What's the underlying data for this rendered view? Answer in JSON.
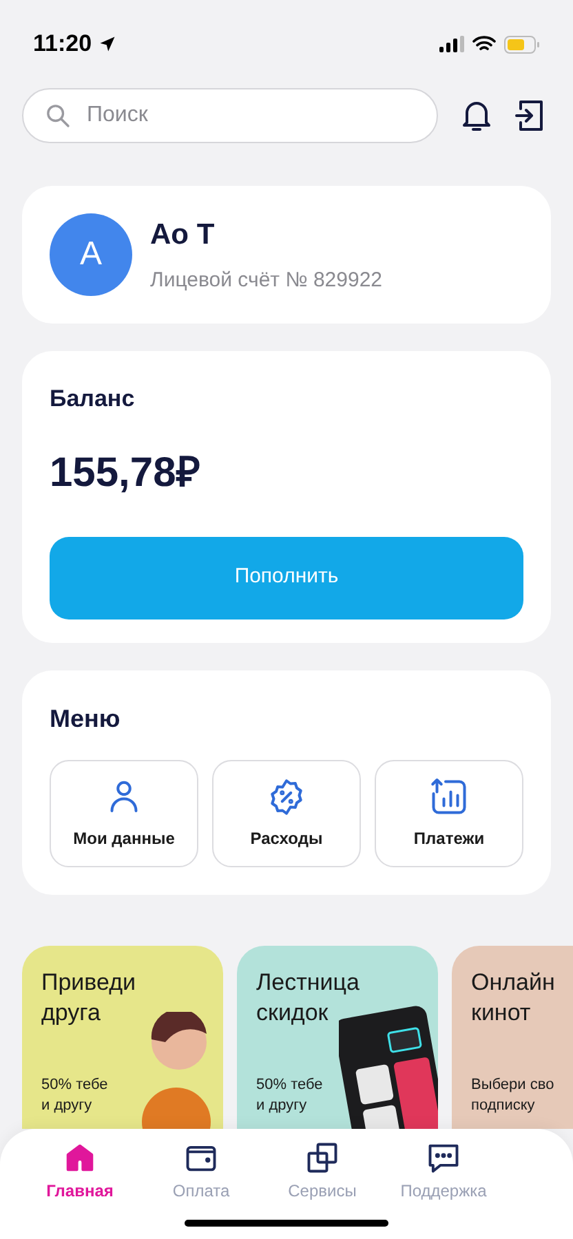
{
  "status_bar": {
    "time": "11:20"
  },
  "search": {
    "placeholder": "Поиск"
  },
  "profile": {
    "initial": "A",
    "name": "Ao T",
    "account": "Лицевой счёт № 829922"
  },
  "balance": {
    "title": "Баланс",
    "amount": "155,78₽",
    "button": "Пополнить"
  },
  "menu": {
    "title": "Меню",
    "items": [
      {
        "kind": "person",
        "label": "Мои данные"
      },
      {
        "kind": "discount",
        "label": "Расходы"
      },
      {
        "kind": "chart",
        "label": "Платежи"
      }
    ]
  },
  "promos": [
    {
      "kind": "friends",
      "color": "#e6e68a",
      "title": [
        "Приведи",
        "друга"
      ],
      "subtitle": [
        "50% тебе",
        "и другу"
      ]
    },
    {
      "kind": "calculator",
      "color": "#b3e2da",
      "title": [
        "Лестница",
        "скидок"
      ],
      "subtitle": [
        "50% тебе",
        "и другу"
      ]
    },
    {
      "kind": "plain",
      "color": "#e6c9b8",
      "title": [
        "Онлайн",
        "кинот"
      ],
      "subtitle": [
        "Выбери сво",
        "подписку"
      ]
    }
  ],
  "tab_bar": [
    {
      "kind": "home",
      "label": "Главная",
      "selected": true
    },
    {
      "kind": "wallet",
      "label": "Оплата",
      "selected": false
    },
    {
      "kind": "squares",
      "label": "Сервисы",
      "selected": false
    },
    {
      "kind": "chat",
      "label": "Поддержка",
      "selected": false
    }
  ]
}
